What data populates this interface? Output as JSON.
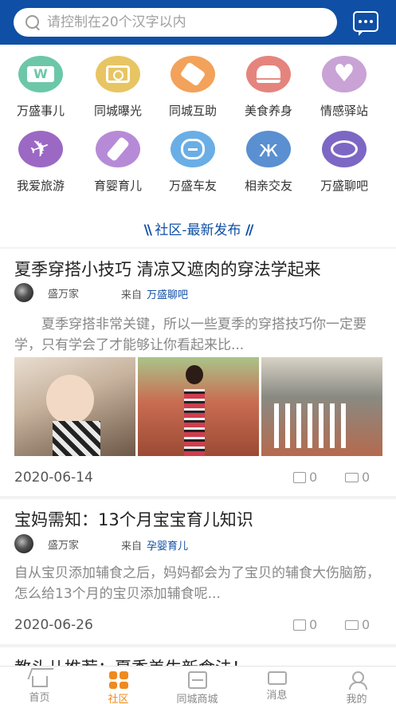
{
  "search": {
    "placeholder": "请控制在20个汉字以内"
  },
  "categories": [
    {
      "label": "万盛事儿",
      "icon": "coffee-cup-w-icon",
      "color": "#6cc7a8"
    },
    {
      "label": "同城曝光",
      "icon": "camera-icon",
      "color": "#e8c563"
    },
    {
      "label": "同城互助",
      "icon": "handshake-icon",
      "color": "#f2a25a"
    },
    {
      "label": "美食养身",
      "icon": "chef-hat-icon",
      "color": "#e5847d"
    },
    {
      "label": "情感驿站",
      "icon": "heart-icon",
      "color": "#c9a2d6"
    },
    {
      "label": "我爱旅游",
      "icon": "airplane-icon",
      "color": "#9b69c4"
    },
    {
      "label": "育婴育儿",
      "icon": "baby-bottle-icon",
      "color": "#b78ad7"
    },
    {
      "label": "万盛车友",
      "icon": "car-icon",
      "color": "#6aaee6"
    },
    {
      "label": "相亲交友",
      "icon": "butterfly-icon",
      "color": "#5a8fd1"
    },
    {
      "label": "万盛聊吧",
      "icon": "chat-bubble-icon",
      "color": "#7d67c4"
    }
  ],
  "section": {
    "title": "社区-最新发布"
  },
  "posts": [
    {
      "title": "夏季穿搭小技巧 清凉又遮肉的穿法学起来",
      "author": "盛万家",
      "from_label": "来自",
      "forum": "万盛聊吧",
      "excerpt": "夏季穿搭非常关键，所以一些夏季的穿搭技巧你一定要学，只有学会了才能够让你看起来比...",
      "date": "2020-06-14",
      "likes": "0",
      "comments": "0"
    },
    {
      "title": "宝妈需知：13个月宝宝育儿知识",
      "author": "盛万家",
      "from_label": "来自",
      "forum": "孕婴育儿",
      "excerpt": "自从宝贝添加辅食之后，妈妈都会为了宝贝的辅食大伤脑筋，怎么给13个月的宝贝添加辅食呢...",
      "date": "2020-06-26",
      "likes": "0",
      "comments": "0"
    }
  ],
  "partial_post": {
    "title": "教头儿推荐：夏季美生新食法！"
  },
  "tabbar": [
    {
      "label": "首页",
      "icon": "home-icon",
      "active": false
    },
    {
      "label": "社区",
      "icon": "grid-icon",
      "active": true
    },
    {
      "label": "同城商城",
      "icon": "shop-icon",
      "active": false
    },
    {
      "label": "消息",
      "icon": "message-icon",
      "active": false
    },
    {
      "label": "我的",
      "icon": "user-icon",
      "active": false
    }
  ],
  "colors": {
    "brand": "#0f4fa5",
    "accent": "#ef8a1f"
  }
}
